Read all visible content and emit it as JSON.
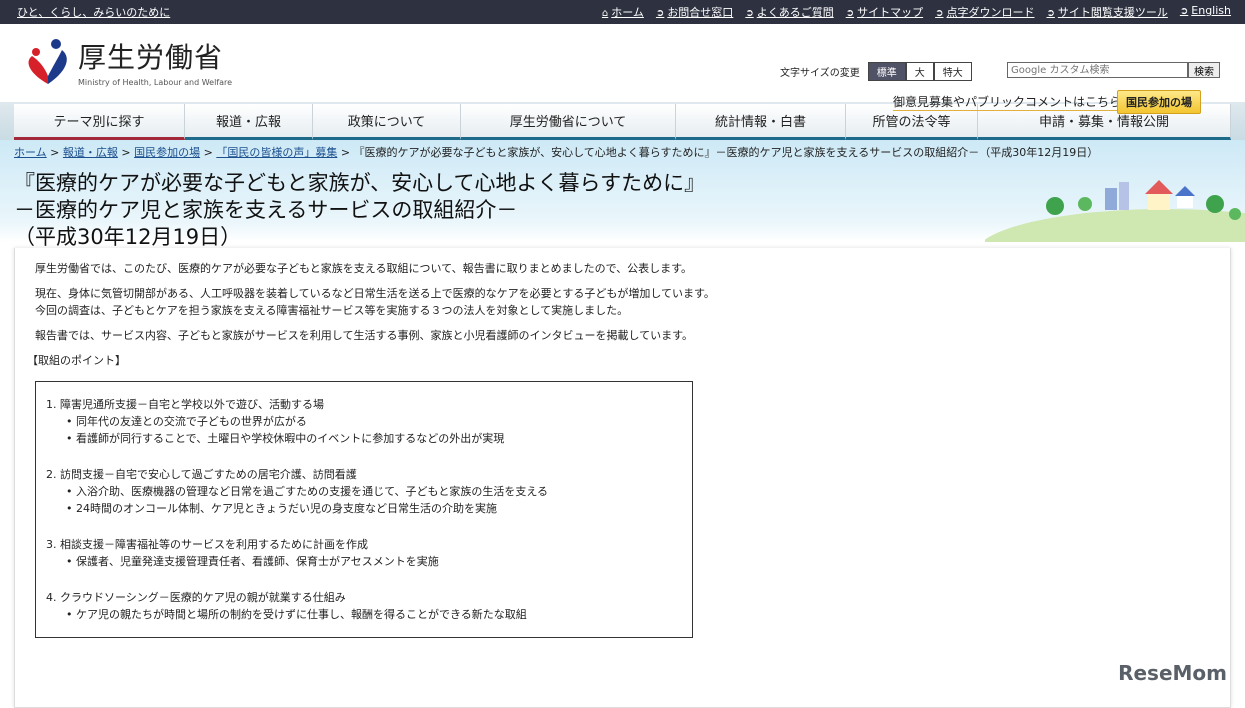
{
  "topbar": {
    "tagline": "ひと、くらし、みらいのために",
    "links": [
      "ホーム",
      "お問合せ窓口",
      "よくあるご質問",
      "サイトマップ",
      "点字ダウンロード",
      "サイト閲覧支援ツール",
      "English"
    ]
  },
  "logo": {
    "jp": "厚生労働省",
    "en": "Ministry of Health, Labour and Welfare"
  },
  "font_size": {
    "label": "文字サイズの変更",
    "options": [
      "標準",
      "大",
      "特大"
    ]
  },
  "search": {
    "placeholder": "Google カスタム検索",
    "button": "検索"
  },
  "public_comment": "御意見募集やパブリックコメントはこちら",
  "kokumin_button": "国民参加の場",
  "nav": [
    "テーマ別に探す",
    "報道・広報",
    "政策について",
    "厚生労働省について",
    "統計情報・白書",
    "所管の法令等",
    "申請・募集・情報公開"
  ],
  "breadcrumb": {
    "links": [
      "ホーム",
      "報道・広報",
      "国民参加の場",
      "「国民の皆様の声」募集"
    ],
    "current": "『医療的ケアが必要な子どもと家族が、安心して心地よく暮らすために』－医療的ケア児と家族を支えるサービスの取組紹介－（平成30年12月19日）"
  },
  "title": [
    "『医療的ケアが必要な子どもと家族が、安心して心地よく暮らすために』",
    "－医療的ケア児と家族を支えるサービスの取組紹介－",
    "（平成30年12月19日）"
  ],
  "paragraphs": [
    "厚生労働省では、このたび、医療的ケアが必要な子どもと家族を支える取組について、報告書に取りまとめましたので、公表します。",
    "現在、身体に気管切開部がある、人工呼吸器を装着しているなど日常生活を送る上で医療的なケアを必要とする子どもが増加しています。",
    "今回の調査は、子どもとケアを担う家族を支える障害福祉サービス等を実施する３つの法人を対象として実施しました。",
    "報告書では、サービス内容、子どもと家族がサービスを利用して生活する事例、家族と小児看護師のインタビューを掲載しています。"
  ],
  "points_label": "【取組のポイント】",
  "points": [
    {
      "h": "1. 障害児通所支援－自宅と学校以外で遊び、活動する場",
      "b": [
        "• 同年代の友達との交流で子どもの世界が広がる",
        "• 看護師が同行することで、土曜日や学校休暇中のイベントに参加するなどの外出が実現"
      ]
    },
    {
      "h": "2. 訪問支援－自宅で安心して過ごすための居宅介護、訪問看護",
      "b": [
        "• 入浴介助、医療機器の管理など日常を過ごすための支援を通じて、子どもと家族の生活を支える",
        "• 24時間のオンコール体制、ケア児ときょうだい児の身支度など日常生活の介助を実施"
      ]
    },
    {
      "h": "3. 相談支援－障害福祉等のサービスを利用するために計画を作成",
      "b": [
        "• 保護者、児童発達支援管理責任者、看護師、保育士がアセスメントを実施"
      ]
    },
    {
      "h": "4. クラウドソーシング－医療的ケア児の親が就業する仕組み",
      "b": [
        "• ケア児の親たちが時間と場所の制約を受けずに仕事し、報酬を得ることができる新たな取組"
      ]
    }
  ],
  "watermark": "ReseMom"
}
